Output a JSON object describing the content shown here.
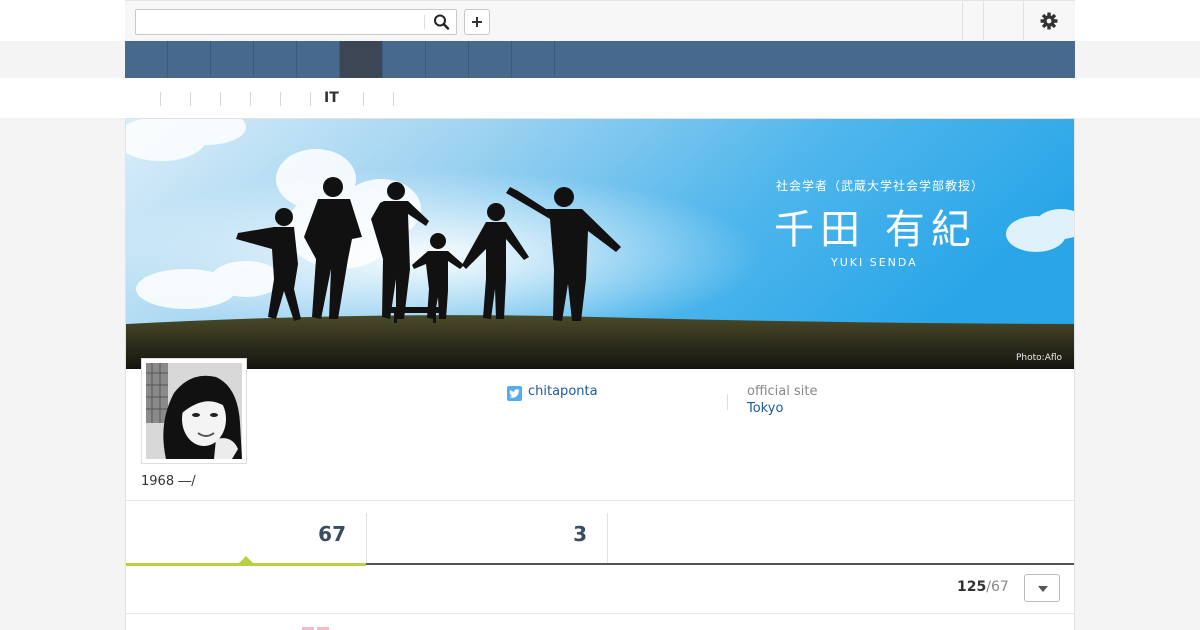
{
  "search": {
    "placeholder": ""
  },
  "subnav": {
    "active_item": "IT"
  },
  "banner": {
    "role": "社会学者（武蔵大学社会学部教授）",
    "name": "千田 有紀",
    "name_roman": "YUKI SENDA",
    "photo_credit": "Photo:Aflo"
  },
  "profile": {
    "twitter_handle": "chitaponta",
    "official_site_label": "official site",
    "location": "Tokyo",
    "birth": "1968 ―/"
  },
  "stats": {
    "count_a": "67",
    "count_b": "3"
  },
  "pager": {
    "current": "125",
    "separator": "/",
    "total": "67"
  },
  "colors": {
    "nav_blue": "#47698e",
    "nav_active": "#3d4654",
    "accent_green": "#b8d141",
    "link_blue": "#1d5a9a",
    "twitter_blue": "#55acee"
  }
}
